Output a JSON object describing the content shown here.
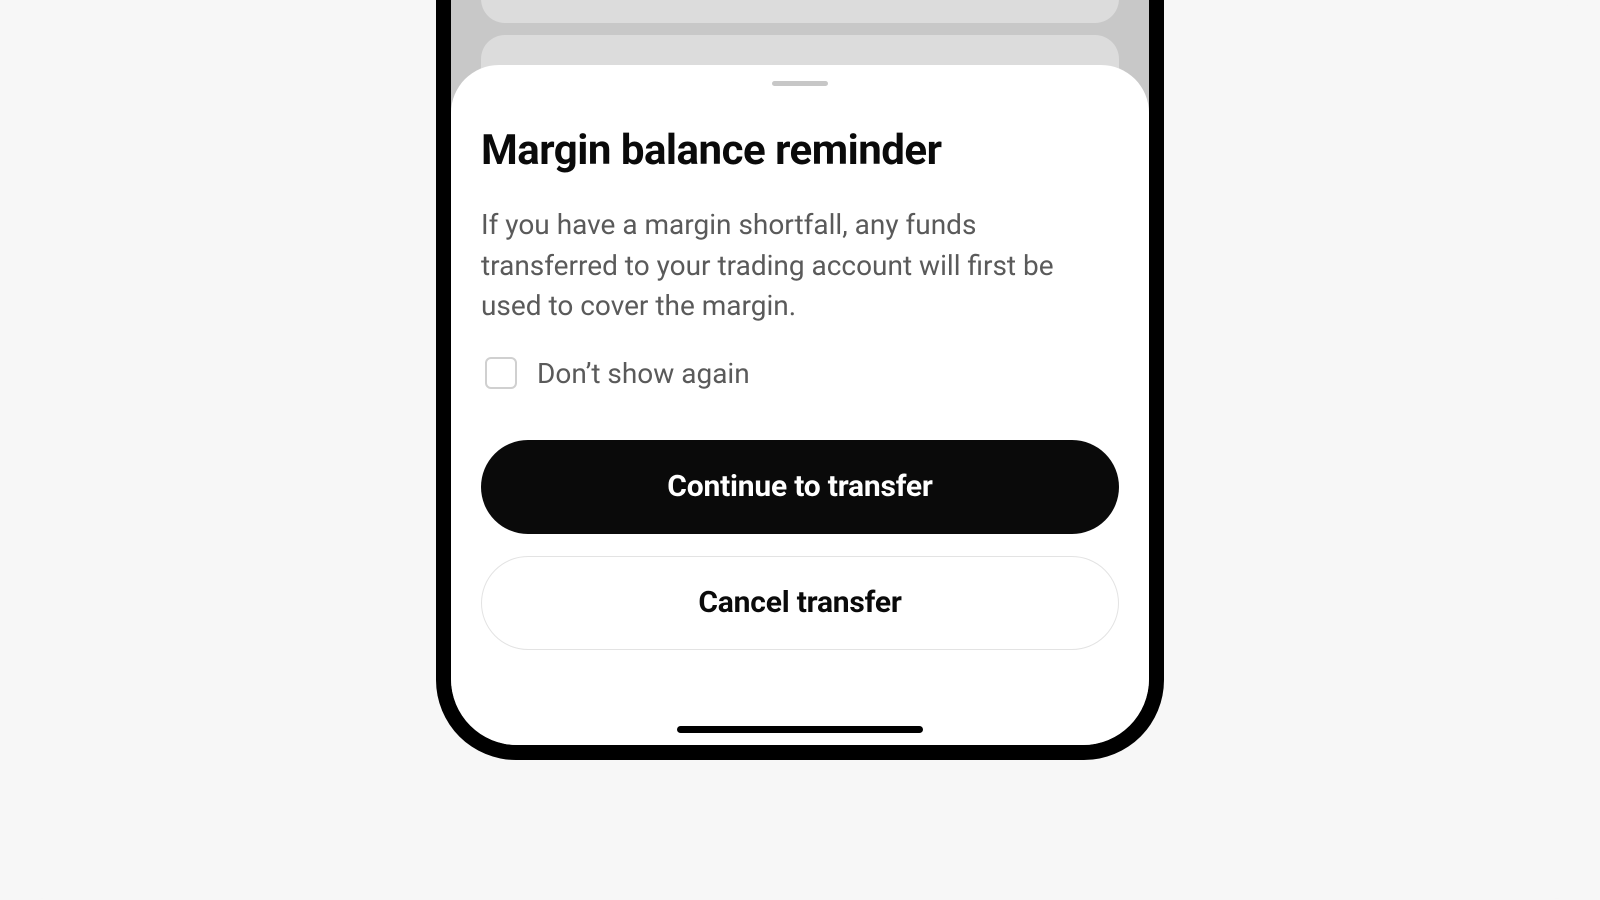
{
  "sheet": {
    "title": "Margin balance reminder",
    "body": "If you have a margin shortfall, any funds transferred to your trading account will first be used to cover the margin.",
    "dont_show_label": "Don’t show again",
    "primary_label": "Continue to transfer",
    "secondary_label": "Cancel transfer"
  }
}
